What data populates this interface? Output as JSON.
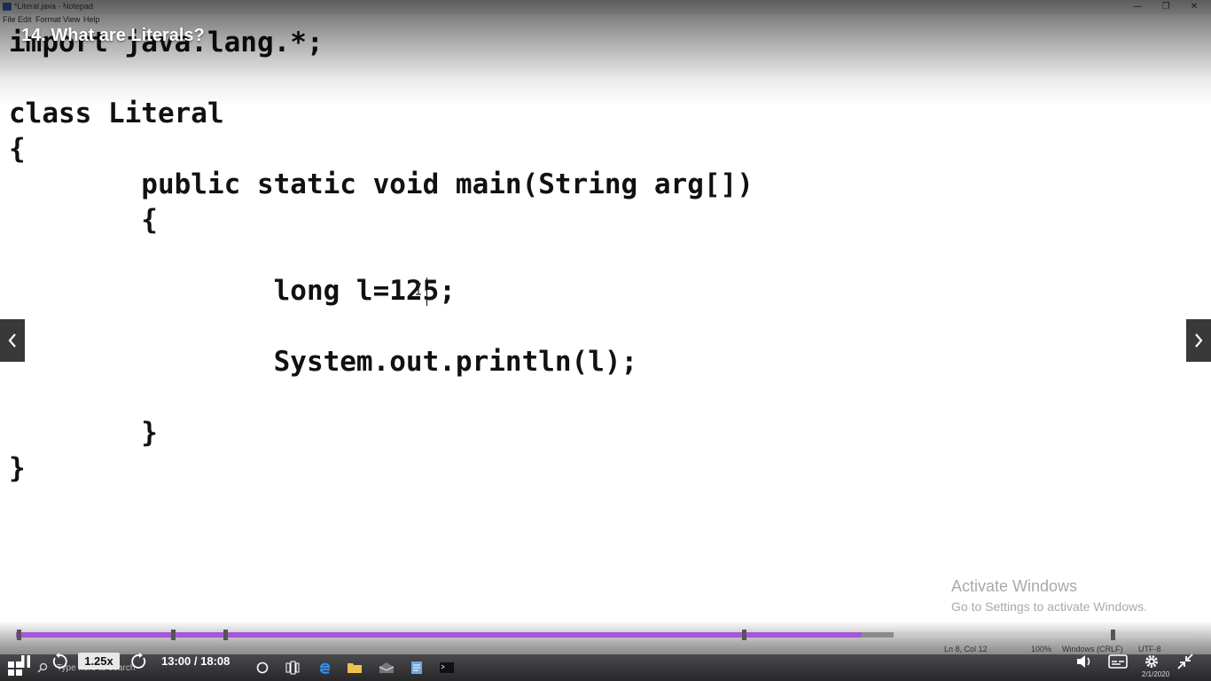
{
  "notepad": {
    "window_title": "*Literal.java - Notepad",
    "menu": [
      "File",
      "Edit",
      "Format",
      "View",
      "Help"
    ],
    "status": {
      "position": "Ln 8, Col 12",
      "zoom": "100%",
      "line_endings": "Windows (CRLF)",
      "encoding": "UTF-8"
    }
  },
  "code": {
    "lines": [
      "import java.lang.*;",
      "",
      "class Literal",
      "{",
      "        public static void main(String arg[])",
      "        {",
      "",
      "                long l=125;",
      "",
      "                System.out.println(l);",
      "",
      "        }",
      "}"
    ]
  },
  "player": {
    "title": "14. What are Literals?",
    "speed": "1.25x",
    "time": "13:00 / 18:08",
    "progress_played_fraction": 0.717,
    "progress_buffered_fraction": 0.744,
    "accent_color": "#a557d8"
  },
  "watermark": {
    "title": "Activate Windows",
    "subtitle": "Go to Settings to activate Windows."
  },
  "taskbar": {
    "search_placeholder": "Type here to search",
    "date": "2/1/2020"
  }
}
